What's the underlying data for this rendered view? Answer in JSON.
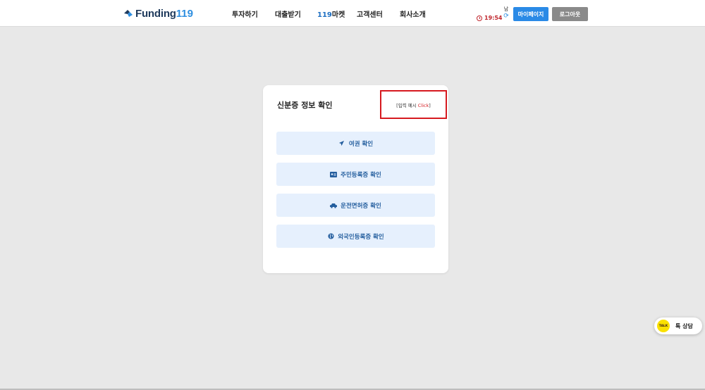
{
  "header": {
    "logo": {
      "text": "Funding",
      "number": "119"
    },
    "nav": [
      {
        "label": "투자하기"
      },
      {
        "label": "대출받기"
      },
      {
        "label_prefix": "119",
        "label": "마켓"
      },
      {
        "label": "고객센터"
      },
      {
        "label": "회사소개"
      }
    ],
    "timer": "19:54",
    "refresh_label": "남",
    "mypage_label": "마이페이지",
    "logout_label": "로그아웃"
  },
  "card": {
    "title": "신분증 정보 확인",
    "example": {
      "prefix": "[입력 예시 ",
      "click": "Click",
      "suffix": "]"
    },
    "buttons": [
      {
        "label": "여권 확인",
        "icon": "airplane-icon"
      },
      {
        "label": "주민등록증 확인",
        "icon": "id-card-icon"
      },
      {
        "label": "운전면허증 확인",
        "icon": "car-icon"
      },
      {
        "label": "외국인등록증 확인",
        "icon": "globe-icon"
      }
    ]
  },
  "kakao": {
    "badge": "TALK",
    "label": "톡 상담"
  },
  "colors": {
    "accent": "#2a8ae6",
    "brand_dark": "#1f3a5c",
    "highlight_red": "#d6191f",
    "button_bg": "#e6f0fd",
    "kakao_yellow": "#fae100"
  }
}
